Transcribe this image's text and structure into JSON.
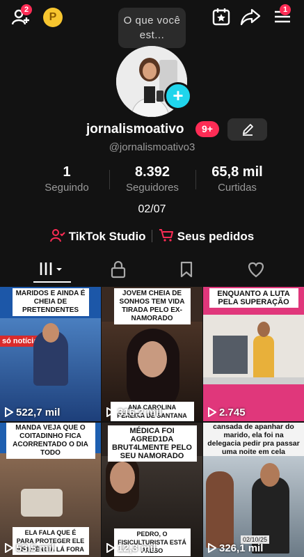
{
  "topbar": {
    "add_friends_badge": "2",
    "coin_label": "P",
    "status_bubble": "O que você est...",
    "menu_badge": "1",
    "icons": [
      "add-user-icon",
      "calendar-star-icon",
      "share-icon",
      "menu-icon"
    ]
  },
  "profile": {
    "username": "jornalismoativo",
    "notification_badge": "9+",
    "handle": "@jornalismoativo3",
    "bio": "02/07",
    "stats": [
      {
        "value": "1",
        "label": "Seguindo"
      },
      {
        "value": "8.392",
        "label": "Seguidores"
      },
      {
        "value": "65,8 mil",
        "label": "Curtidas"
      }
    ]
  },
  "links": {
    "studio": "TikTok Studio",
    "orders": "Seus pedidos"
  },
  "videos": [
    {
      "caption": "MARIDOS E AINDA É CHEIA DE PRETENDENTES",
      "overlay": "só notícias",
      "views": "522,7 mil"
    },
    {
      "caption": "JOVEM CHEIA DE SONHOS TEM VIDA TIRADA PELO EX-NAMORADO",
      "overlay": "ANA CAROLINA PEREIRA DE SANTANA TINHA",
      "views": "316,2 mil"
    },
    {
      "caption": "ENQUANTO A LUTA PELA SUPERAÇÃO",
      "overlay": "",
      "views": "2.745"
    },
    {
      "caption": "MANDA VEJA QUE O COITADINHO FICA ACORRENTADO O DIA TODO",
      "overlay": "ELA FALA QUE É PARA PROTEGER ELE INFLUÊNCIA LÁ FORA",
      "views": "53,5 mil"
    },
    {
      "caption": "MÉDICA FOI AGRED1DA BRUT4LMENTE PELO SEU NAMORADO",
      "overlay": "PEDRO, O FISICULTURISTA ESTÁ PRESO",
      "views": "12,3 mil"
    },
    {
      "caption": "cansada de apanhar do marido, ela foi na delegacia pedir pra passar uma noite em cela",
      "overlay": "02/10/25",
      "views": "326,1 mil"
    }
  ],
  "colors": {
    "accent": "#fe2c55",
    "plus": "#20d5ec",
    "background": "#121212"
  }
}
